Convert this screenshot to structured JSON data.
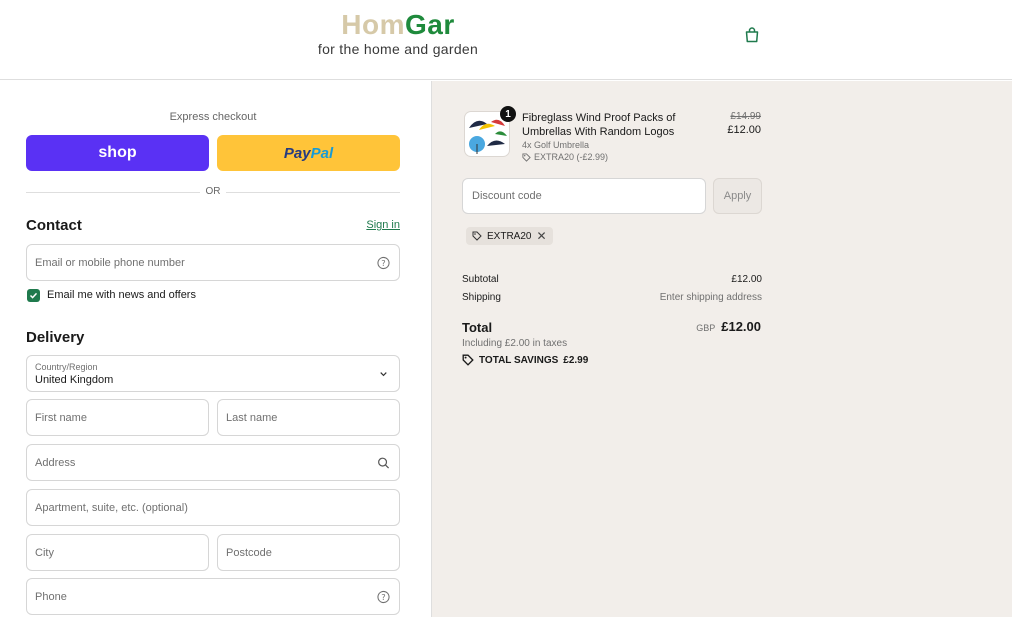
{
  "header": {
    "logo_part1": "Hom",
    "logo_part2": "Gar",
    "tagline": "for the home and garden",
    "cart_icon": "shopping-bag-icon"
  },
  "express": {
    "label": "Express checkout",
    "shop_label": "shop",
    "paypal_part1": "Pay",
    "paypal_part2": "Pal",
    "or_label": "OR"
  },
  "contact": {
    "heading": "Contact",
    "signin_label": "Sign in",
    "email_placeholder": "Email or mobile phone number",
    "newsletter_label": "Email me with news and offers",
    "newsletter_checked": true
  },
  "delivery": {
    "heading": "Delivery",
    "country_label": "Country/Region",
    "country_value": "United Kingdom",
    "first_name_placeholder": "First name",
    "last_name_placeholder": "Last name",
    "address_placeholder": "Address",
    "apartment_placeholder": "Apartment, suite, etc. (optional)",
    "city_placeholder": "City",
    "postcode_placeholder": "Postcode",
    "phone_placeholder": "Phone"
  },
  "order": {
    "item": {
      "title": "Fibreglass Wind Proof Packs of Umbrellas With Random Logos",
      "quantity": "1",
      "variant": "4x Golf Umbrella",
      "discount": "EXTRA20 (-£2.99)",
      "original_price": "£14.99",
      "price": "£12.00"
    },
    "discount_placeholder": "Discount code",
    "apply_label": "Apply",
    "applied_code": "EXTRA20",
    "subtotal_label": "Subtotal",
    "subtotal_value": "£12.00",
    "shipping_label": "Shipping",
    "shipping_value": "Enter shipping address",
    "total_label": "Total",
    "currency": "GBP",
    "total_value": "£12.00",
    "taxes_note": "Including £2.00 in taxes",
    "savings_label": "TOTAL SAVINGS",
    "savings_value": "£2.99"
  },
  "colors": {
    "brand_green": "#1f7a4d",
    "shop_purple": "#5a31f4",
    "paypal_yellow": "#ffc439",
    "summary_bg": "#f2eeea"
  }
}
